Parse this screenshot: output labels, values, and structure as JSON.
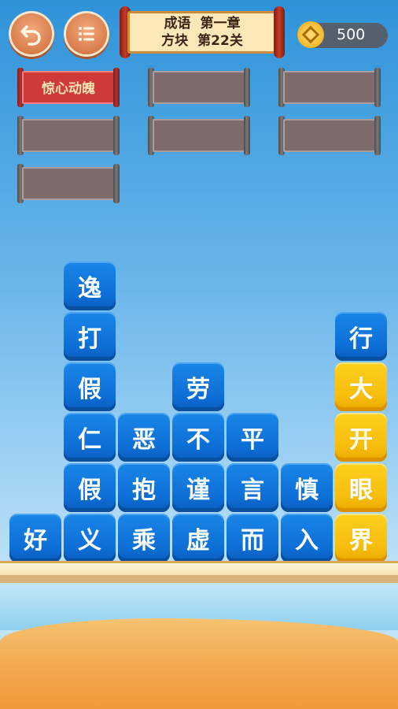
{
  "header": {
    "back_icon": "undo-arrow-icon",
    "menu_icon": "menu-list-icon",
    "title_line1_a": "成语",
    "title_line1_b": "第一章",
    "title_line2_a": "方块",
    "title_line2_b": "第22关",
    "coins": "500",
    "coin_icon": "coin-icon"
  },
  "answers": [
    {
      "text": "惊心动魄",
      "solved": true
    },
    {
      "text": "",
      "solved": false
    },
    {
      "text": "",
      "solved": false
    },
    {
      "text": "",
      "solved": false
    },
    {
      "text": "",
      "solved": false
    },
    {
      "text": "",
      "solved": false
    },
    {
      "text": "",
      "solved": false
    }
  ],
  "columns": [
    {
      "tiles": [
        "好"
      ],
      "color": "blue"
    },
    {
      "tiles": [
        "义",
        "假",
        "仁",
        "假",
        "打",
        "逸"
      ],
      "color": "blue"
    },
    {
      "tiles": [
        "乘",
        "抱",
        "恶"
      ],
      "color": "blue"
    },
    {
      "tiles": [
        "虚",
        "谨",
        "不",
        "劳"
      ],
      "color": "blue"
    },
    {
      "tiles": [
        "而",
        "言",
        "平"
      ],
      "color": "blue"
    },
    {
      "tiles": [
        "入",
        "慎"
      ],
      "color": "blue"
    },
    {
      "tiles": [
        "界",
        "眼",
        "开",
        "大",
        "行"
      ],
      "color": "mixed",
      "blue_from": 4
    }
  ],
  "colors": {
    "tile_blue": "#0d6fd6",
    "tile_yellow": "#f7bd0c",
    "solved_slot": "#d0393a",
    "empty_slot": "#7e6b6b"
  }
}
